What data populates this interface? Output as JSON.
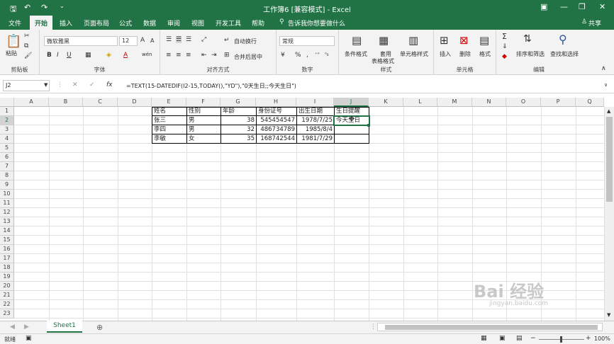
{
  "window": {
    "title": "工作簿6 [兼容模式] - Excel",
    "min_icon": "minimize-icon",
    "max_icon": "restore-icon",
    "close_icon": "close-icon"
  },
  "quick_access": {
    "save": "🖫",
    "undo": "↶",
    "redo": "↷",
    "more": "⌄"
  },
  "tabs": [
    "文件",
    "开始",
    "插入",
    "页面布局",
    "公式",
    "数据",
    "审阅",
    "视图",
    "开发工具",
    "帮助"
  ],
  "tell_me": "告诉我你想要做什么",
  "share": "共享",
  "ribbon": {
    "clipboard": {
      "paste": "粘贴",
      "label": "剪贴板"
    },
    "font": {
      "name": "微软雅黑",
      "size": "12",
      "label": "字体",
      "bold": "B",
      "italic": "I",
      "underline": "U",
      "grow": "A",
      "shrink": "A",
      "color_a": "A",
      "wen": "wén"
    },
    "align": {
      "wrap": "自动换行",
      "merge": "合并后居中",
      "label": "对齐方式"
    },
    "number": {
      "format": "常规",
      "label": "数字",
      "percent": "%",
      "comma": ","
    },
    "styles": {
      "conditional": "条件格式",
      "table1": "套用",
      "table2": "表格格式",
      "cell": "单元格样式",
      "label": "样式"
    },
    "cells": {
      "insert": "插入",
      "delete": "删除",
      "format": "格式",
      "label": "单元格"
    },
    "edit": {
      "sort": "排序和筛选",
      "find": "查找和选择",
      "label": "编辑"
    }
  },
  "formula_bar": {
    "name_box": "J2",
    "fx": "fx",
    "formula": "=TEXT(15-DATEDIF(I2-15,TODAY(),\"YD\"),\"0天生日;;今天生日\")"
  },
  "columns": [
    "A",
    "B",
    "C",
    "D",
    "E",
    "F",
    "G",
    "H",
    "I",
    "J",
    "K",
    "L",
    "M",
    "N",
    "O",
    "P",
    "Q"
  ],
  "rows": [
    "1",
    "2",
    "3",
    "4",
    "5",
    "6",
    "7",
    "8",
    "9",
    "10",
    "11",
    "12",
    "13",
    "14",
    "15",
    "16",
    "17",
    "18",
    "19",
    "20",
    "21",
    "22",
    "23"
  ],
  "table": {
    "headers": [
      "姓名",
      "性别",
      "年龄",
      "身份证号",
      "出生日期",
      "生日提醒"
    ],
    "data": [
      [
        "张三",
        "男",
        "38",
        "545454547",
        "1978/7/25",
        "今天生日"
      ],
      [
        "李四",
        "男",
        "32",
        "486734789",
        "1985/8/4",
        ""
      ],
      [
        "李敏",
        "女",
        "35",
        "168742544",
        "1981/7/29",
        ""
      ]
    ]
  },
  "sheet": {
    "tab": "Sheet1",
    "add": "⊕"
  },
  "status": {
    "ready": "就绪",
    "zoom": "100%"
  },
  "watermark": {
    "text": "Bai 经验",
    "sub": "jingyan.baidu.com"
  }
}
